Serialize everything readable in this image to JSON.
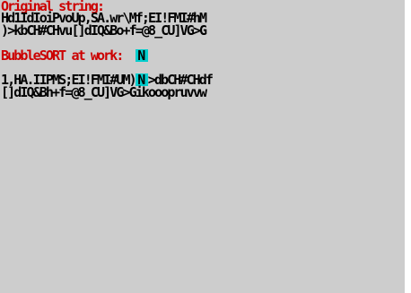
{
  "colors": {
    "paper": "#cdcdcd",
    "ink": "#000000",
    "heading": "#cc0000",
    "cursor_bg": "#00cdcd"
  },
  "screen": {
    "original_heading": "Original string:",
    "original_line_1": "Hd1IdIoiPvoUp,SA.wr\\Mf;EI!FMI#hM",
    "original_line_2": ")>kbCH#CHvu[]dIQ&Bo+f=@8_CU]VG>G",
    "bubble_heading": "BubbleSORT at work:",
    "bubble_cursor_glyph": "N",
    "work_line_1_left": "1,HA.IIPMS;EI!FMI#UM)",
    "work_line_1_cursor": "N",
    "work_line_1_right": ">dbCH#CHdf",
    "work_line_2": "[]dIQ&Bh+f=@8_CU]VG>Gikooopruvvw"
  }
}
